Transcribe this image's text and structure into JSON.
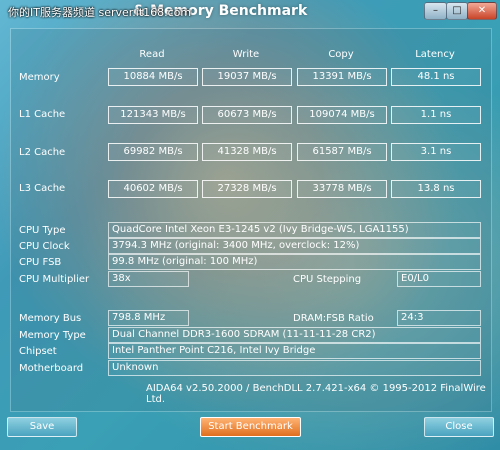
{
  "window": {
    "title": "& Memory Benchmark",
    "watermark": "你的IT服务器频道 server.it168.com",
    "controls": {
      "minimize": "–",
      "maximize": "□",
      "close": "✕"
    }
  },
  "columns": [
    "Read",
    "Write",
    "Copy",
    "Latency"
  ],
  "rows": [
    {
      "label": "Memory",
      "read": "10884 MB/s",
      "write": "19037 MB/s",
      "copy": "13391 MB/s",
      "latency": "48.1 ns"
    },
    {
      "label": "L1 Cache",
      "read": "121343 MB/s",
      "write": "60673 MB/s",
      "copy": "109074 MB/s",
      "latency": "1.1 ns"
    },
    {
      "label": "L2 Cache",
      "read": "69982 MB/s",
      "write": "41328 MB/s",
      "copy": "61587 MB/s",
      "latency": "3.1 ns"
    },
    {
      "label": "L3 Cache",
      "read": "40602 MB/s",
      "write": "27328 MB/s",
      "copy": "33778 MB/s",
      "latency": "13.8 ns"
    }
  ],
  "cpu": {
    "type_label": "CPU Type",
    "type_value": "QuadCore Intel Xeon E3-1245 v2  (Ivy Bridge-WS, LGA1155)",
    "clock_label": "CPU Clock",
    "clock_value": "3794.3 MHz  (original: 3400 MHz, overclock: 12%)",
    "fsb_label": "CPU FSB",
    "fsb_value": "99.8 MHz  (original: 100 MHz)",
    "multiplier_label": "CPU Multiplier",
    "multiplier_value": "38x",
    "stepping_label": "CPU Stepping",
    "stepping_value": "E0/L0"
  },
  "memory": {
    "bus_label": "Memory Bus",
    "bus_value": "798.8 MHz",
    "ratio_label": "DRAM:FSB Ratio",
    "ratio_value": "24:3",
    "type_label": "Memory Type",
    "type_value": "Dual Channel DDR3-1600 SDRAM  (11-11-11-28 CR2)",
    "chipset_label": "Chipset",
    "chipset_value": "Intel Panther Point C216, Intel Ivy Bridge",
    "mobo_label": "Motherboard",
    "mobo_value": "Unknown"
  },
  "version": "AIDA64 v2.50.2000 / BenchDLL 2.7.421-x64  © 1995-2012 FinalWire Ltd.",
  "buttons": {
    "save": "Save",
    "start": "Start Benchmark",
    "close": "Close"
  }
}
